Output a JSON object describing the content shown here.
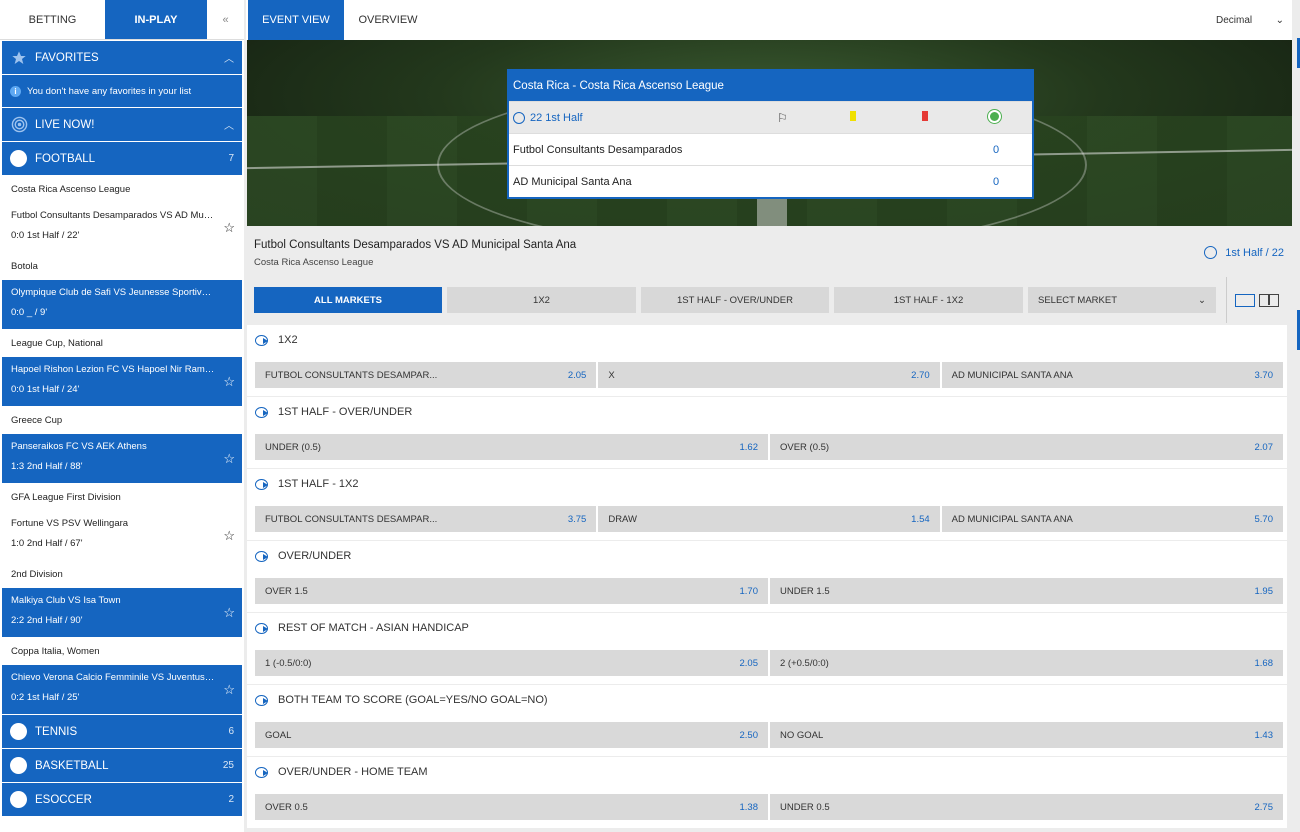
{
  "nav": {
    "betting": "BETTING",
    "inplay": "IN-PLAY",
    "collapse": "«"
  },
  "sidebar": {
    "favorites": {
      "label": "FAVORITES",
      "note": "You don't have any favorites in your list"
    },
    "live_now": {
      "label": "LIVE NOW!"
    },
    "football": {
      "label": "FOOTBALL",
      "count": "7"
    },
    "groups": [
      {
        "league": "Costa Rica Ascenso League",
        "match": "Futbol Consultants Desamparados VS AD Municipal Santa Ana",
        "score": "0:0 1st Half / 22'",
        "style": "white"
      },
      {
        "league": "Botola",
        "match": "Olympique Club de Safi VS Jeunesse Sportive Soualem",
        "score": "0:0 _ / 9'",
        "style": "blue"
      },
      {
        "league": "League Cup, National",
        "match": "Hapoel Rishon Lezion FC VS Hapoel Nir Ramat HaSharon",
        "score": "0:0 1st Half / 24'",
        "style": "blue"
      },
      {
        "league": "Greece Cup",
        "match": "Panseraikos FC VS AEK Athens",
        "score": "1:3 2nd Half / 88'",
        "style": "blue"
      },
      {
        "league": "GFA League First Division",
        "match": "Fortune VS PSV Wellingara",
        "score": "1:0 2nd Half / 67'",
        "style": "white"
      },
      {
        "league": "2nd Division",
        "match": "Malkiya Club VS Isa Town",
        "score": "2:2 2nd Half / 90'",
        "style": "blue"
      },
      {
        "league": "Coppa Italia, Women",
        "match": "Chievo Verona Calcio Femminile VS Juventus Turin Women",
        "score": "0:2 1st Half / 25'",
        "style": "blue"
      }
    ],
    "sports": [
      {
        "label": "TENNIS",
        "count": "6"
      },
      {
        "label": "BASKETBALL",
        "count": "25"
      },
      {
        "label": "ESOCCER",
        "count": "2"
      }
    ]
  },
  "main": {
    "tabs": {
      "event_view": "EVENT VIEW",
      "overview": "OVERVIEW"
    },
    "odds_format": "Decimal",
    "scoreboard": {
      "title": "Costa Rica - Costa Rica Ascenso League",
      "time": "22 1st Half",
      "home": "Futbol Consultants Desamparados",
      "away": "AD Municipal Santa Ana",
      "home_score": "0",
      "away_score": "0"
    },
    "event": {
      "title": "Futbol Consultants Desamparados VS AD Municipal Santa Ana",
      "league": "Costa Rica Ascenso League",
      "time": "1st Half / 22"
    },
    "market_tabs": [
      "ALL MARKETS",
      "1X2",
      "1ST HALF - OVER/UNDER",
      "1ST HALF - 1X2"
    ],
    "select_market": "SELECT MARKET",
    "markets": [
      {
        "title": "1X2",
        "odds": [
          {
            "n": "FUTBOL CONSULTANTS DESAMPAR...",
            "v": "2.05"
          },
          {
            "n": "X",
            "v": "2.70"
          },
          {
            "n": "AD MUNICIPAL SANTA ANA",
            "v": "3.70"
          }
        ]
      },
      {
        "title": "1ST HALF - OVER/UNDER",
        "odds": [
          {
            "n": "UNDER (0.5)",
            "v": "1.62"
          },
          {
            "n": "OVER (0.5)",
            "v": "2.07"
          }
        ]
      },
      {
        "title": "1ST HALF - 1X2",
        "odds": [
          {
            "n": "FUTBOL CONSULTANTS DESAMPAR...",
            "v": "3.75"
          },
          {
            "n": "DRAW",
            "v": "1.54"
          },
          {
            "n": "AD MUNICIPAL SANTA ANA",
            "v": "5.70"
          }
        ]
      },
      {
        "title": "OVER/UNDER",
        "odds": [
          {
            "n": "OVER 1.5",
            "v": "1.70"
          },
          {
            "n": "UNDER 1.5",
            "v": "1.95"
          }
        ]
      },
      {
        "title": "REST OF MATCH - ASIAN HANDICAP",
        "odds": [
          {
            "n": "1 (-0.5/0:0)",
            "v": "2.05"
          },
          {
            "n": "2 (+0.5/0:0)",
            "v": "1.68"
          }
        ]
      },
      {
        "title": "BOTH TEAM TO SCORE (GOAL=YES/NO GOAL=NO)",
        "odds": [
          {
            "n": "GOAL",
            "v": "2.50"
          },
          {
            "n": "NO GOAL",
            "v": "1.43"
          }
        ]
      },
      {
        "title": "OVER/UNDER - HOME TEAM",
        "odds": [
          {
            "n": "OVER 0.5",
            "v": "1.38"
          },
          {
            "n": "UNDER 0.5",
            "v": "2.75"
          }
        ]
      }
    ]
  },
  "colors": {
    "brand": "#1565c0",
    "odds_bg": "#d9d9d9"
  }
}
